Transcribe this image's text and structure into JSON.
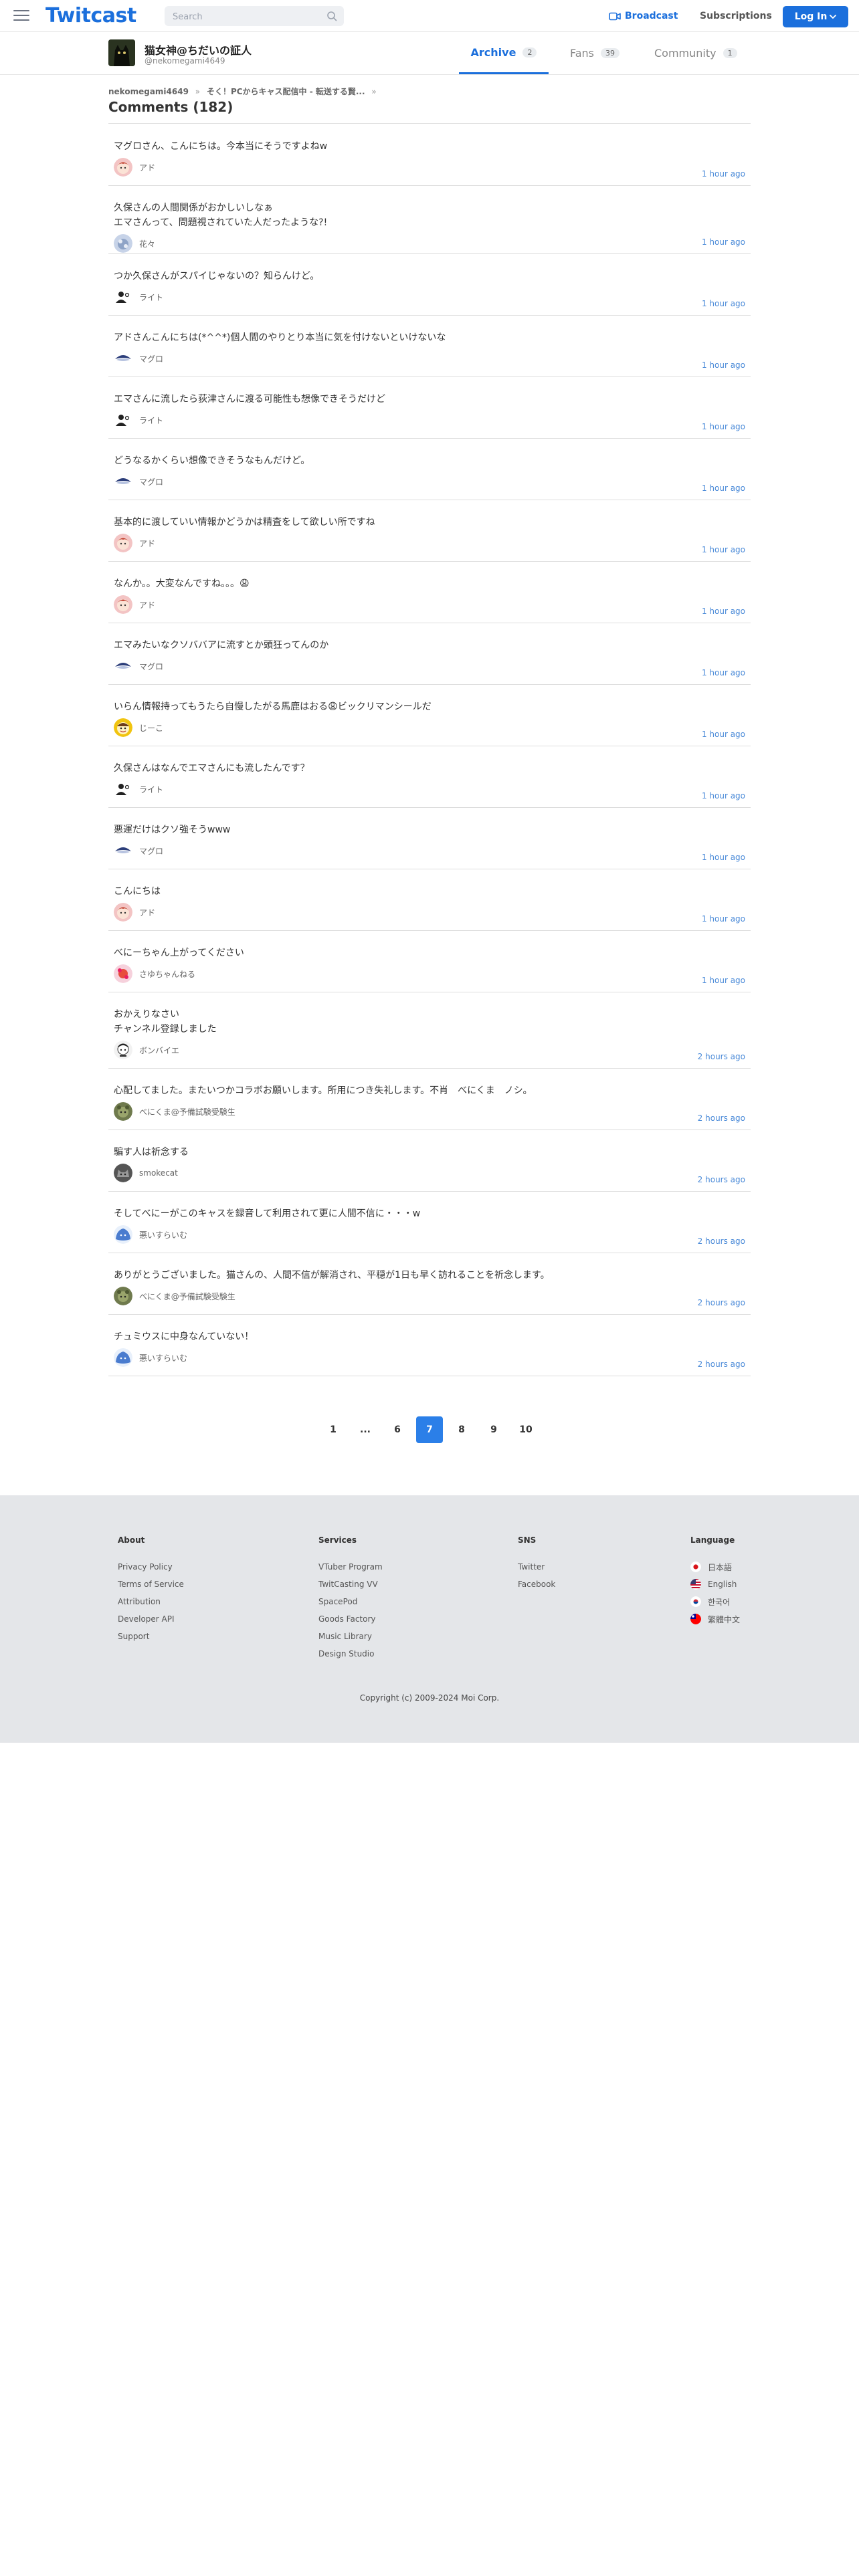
{
  "header": {
    "logo": "Twitcast",
    "search_placeholder": "Search",
    "broadcast": "Broadcast",
    "subscriptions": "Subscriptions",
    "login": "Log In"
  },
  "user": {
    "name": "猫女神@ちだいの証人",
    "handle": "@nekomegami4649",
    "tabs": [
      {
        "label": "Archive",
        "count": "2"
      },
      {
        "label": "Fans",
        "count": "39"
      },
      {
        "label": "Community",
        "count": "1"
      }
    ]
  },
  "breadcrumb": {
    "user": "nekomegami4649",
    "movie": "そく！PCからキャス配信中 - 転送する賢...",
    "sep": "»"
  },
  "page_title": "Comments (182)",
  "comments": [
    {
      "text": "マグロさん、こんにちは。今本当にそうですよねw",
      "user": "アド",
      "time": "1 hour ago",
      "avatar": "ado"
    },
    {
      "text": "久保さんの人間関係がおかしいしなぁ\nエマさんって、問題視されていた人だったような?!",
      "user": "花々",
      "time": "1 hour ago",
      "avatar": "hana"
    },
    {
      "text": "つか久保さんがスパイじゃないの？知らんけど。",
      "user": "ライト",
      "time": "1 hour ago",
      "avatar": "light"
    },
    {
      "text": "アドさんこんにちは(*^^*)個人間のやりとり本当に気を付けないといけないな",
      "user": "マグロ",
      "time": "1 hour ago",
      "avatar": "maguro"
    },
    {
      "text": "エマさんに流したら荻津さんに渡る可能性も想像できそうだけど",
      "user": "ライト",
      "time": "1 hour ago",
      "avatar": "light"
    },
    {
      "text": "どうなるかくらい想像できそうなもんだけど。",
      "user": "マグロ",
      "time": "1 hour ago",
      "avatar": "maguro"
    },
    {
      "text": "基本的に渡していい情報かどうかは精査をして欲しい所ですね",
      "user": "アド",
      "time": "1 hour ago",
      "avatar": "ado"
    },
    {
      "text": "なんか。。大変なんですね。。。😩",
      "user": "アド",
      "time": "1 hour ago",
      "avatar": "ado"
    },
    {
      "text": "エマみたいなクソババアに流すとか頭狂ってんのか",
      "user": "マグロ",
      "time": "1 hour ago",
      "avatar": "maguro"
    },
    {
      "text": "いらん情報持ってもうたら自慢したがる馬鹿はおる😩ビックリマンシールだ",
      "user": "じーこ",
      "time": "1 hour ago",
      "avatar": "jiko"
    },
    {
      "text": "久保さんはなんでエマさんにも流したんです？",
      "user": "ライト",
      "time": "1 hour ago",
      "avatar": "light"
    },
    {
      "text": "悪運だけはクソ強そうwww",
      "user": "マグロ",
      "time": "1 hour ago",
      "avatar": "maguro"
    },
    {
      "text": "こんにちは",
      "user": "アド",
      "time": "1 hour ago",
      "avatar": "ado"
    },
    {
      "text": "べにーちゃん上がってください",
      "user": "さゆちゃんねる",
      "time": "1 hour ago",
      "avatar": "sayu"
    },
    {
      "text": "おかえりなさい\nチャンネル登録しました",
      "user": "ボンバイエ",
      "time": "2 hours ago",
      "avatar": "bonbaye"
    },
    {
      "text": "心配してました。またいつかコラボお願いします。所用につき失礼します。不肖　べにくま　ノシ。",
      "user": "べにくま@予備試験受験生",
      "time": "2 hours ago",
      "avatar": "benikuma"
    },
    {
      "text": "騙す人は祈念する",
      "user": "smokecat",
      "time": "2 hours ago",
      "avatar": "smokecat"
    },
    {
      "text": "そしてべにーがこのキャスを録音して利用されて更に人間不信に・・・w",
      "user": "悪いすらいむ",
      "time": "2 hours ago",
      "avatar": "slime"
    },
    {
      "text": "ありがとうございました。猫さんの、人間不信が解消され、平穏が1日も早く訪れることを祈念します。",
      "user": "べにくま@予備試験受験生",
      "time": "2 hours ago",
      "avatar": "benikuma"
    },
    {
      "text": "チュミウスに中身なんていない！",
      "user": "悪いすらいむ",
      "time": "2 hours ago",
      "avatar": "slime"
    }
  ],
  "pagination": [
    "1",
    "...",
    "6",
    "7",
    "8",
    "9",
    "10"
  ],
  "pagination_current": "7",
  "footer": {
    "about": {
      "title": "About",
      "links": [
        "Privacy Policy",
        "Terms of Service",
        "Attribution",
        "Developer API",
        "Support"
      ]
    },
    "services": {
      "title": "Services",
      "links": [
        "VTuber Program",
        "TwitCasting VV",
        "SpacePod",
        "Goods Factory",
        "Music Library",
        "Design Studio"
      ]
    },
    "sns": {
      "title": "SNS",
      "links": [
        "Twitter",
        "Facebook"
      ]
    },
    "language": {
      "title": "Language",
      "links": [
        "日本語",
        "English",
        "한국어",
        "繁體中文"
      ]
    },
    "copyright": "Copyright (c) 2009-2024 Moi Corp."
  },
  "colors": {
    "accent": "#1b6fdc",
    "time_link": "#4a8ad8",
    "footer_bg": "#e4e6e9"
  }
}
